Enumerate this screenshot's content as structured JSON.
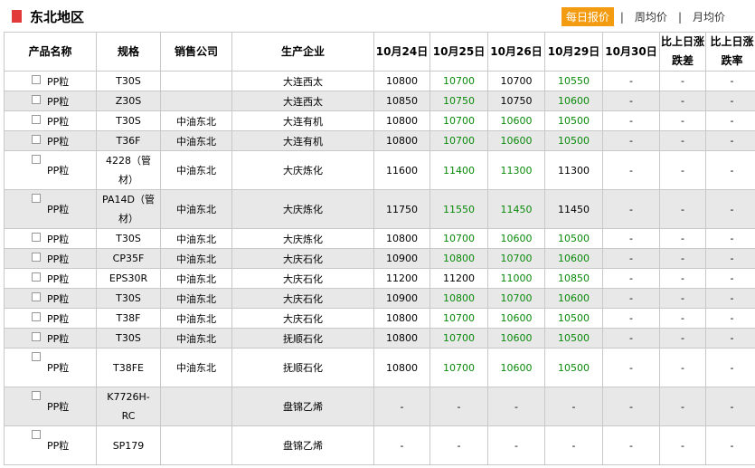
{
  "header": {
    "title": "东北地区",
    "tabs": [
      {
        "label": "每日报价",
        "active": true
      },
      {
        "label": "周均价",
        "active": false
      },
      {
        "label": "月均价",
        "active": false
      }
    ],
    "separator": "|"
  },
  "table": {
    "columns": [
      "产品名称",
      "规格",
      "销售公司",
      "生产企业",
      "10月24日",
      "10月25日",
      "10月26日",
      "10月29日",
      "10月30日",
      "比上日涨跌差",
      "比上日涨跌率"
    ],
    "rows": [
      {
        "product": "PP粒",
        "spec": "T30S",
        "seller": "",
        "producer": "大连西太",
        "d24": "10800",
        "d25": "10700",
        "d26": "10700",
        "d29": "10550",
        "d30": "-",
        "diff": "-",
        "rate": "-",
        "h": 22
      },
      {
        "product": "PP粒",
        "spec": "Z30S",
        "seller": "",
        "producer": "大连西太",
        "d24": "10850",
        "d25": "10750",
        "d26": "10750",
        "d29": "10600",
        "d30": "-",
        "diff": "-",
        "rate": "-",
        "h": 22
      },
      {
        "product": "PP粒",
        "spec": "T30S",
        "seller": "中油东北",
        "producer": "大连有机",
        "d24": "10800",
        "d25": "10700",
        "d26": "10600",
        "d29": "10500",
        "d30": "-",
        "diff": "-",
        "rate": "-",
        "h": 22
      },
      {
        "product": "PP粒",
        "spec": "T36F",
        "seller": "中油东北",
        "producer": "大连有机",
        "d24": "10800",
        "d25": "10700",
        "d26": "10600",
        "d29": "10500",
        "d30": "-",
        "diff": "-",
        "rate": "-",
        "h": 22
      },
      {
        "product": "PP粒",
        "spec": "4228（管材）",
        "seller": "中油东北",
        "producer": "大庆炼化",
        "d24": "11600",
        "d25": "11400",
        "d26": "11300",
        "d29": "11300",
        "d30": "-",
        "diff": "-",
        "rate": "-",
        "h": 43
      },
      {
        "product": "PP粒",
        "spec": "PA14D（管材）",
        "seller": "中油东北",
        "producer": "大庆炼化",
        "d24": "11750",
        "d25": "11550",
        "d26": "11450",
        "d29": "11450",
        "d30": "-",
        "diff": "-",
        "rate": "-",
        "h": 43
      },
      {
        "product": "PP粒",
        "spec": "T30S",
        "seller": "中油东北",
        "producer": "大庆炼化",
        "d24": "10800",
        "d25": "10700",
        "d26": "10600",
        "d29": "10500",
        "d30": "-",
        "diff": "-",
        "rate": "-",
        "h": 22
      },
      {
        "product": "PP粒",
        "spec": "CP35F",
        "seller": "中油东北",
        "producer": "大庆石化",
        "d24": "10900",
        "d25": "10800",
        "d26": "10700",
        "d29": "10600",
        "d30": "-",
        "diff": "-",
        "rate": "-",
        "h": 22
      },
      {
        "product": "PP粒",
        "spec": "EPS30R",
        "seller": "中油东北",
        "producer": "大庆石化",
        "d24": "11200",
        "d25": "11200",
        "d26": "11000",
        "d29": "10850",
        "d30": "-",
        "diff": "-",
        "rate": "-",
        "h": 22
      },
      {
        "product": "PP粒",
        "spec": "T30S",
        "seller": "中油东北",
        "producer": "大庆石化",
        "d24": "10900",
        "d25": "10800",
        "d26": "10700",
        "d29": "10600",
        "d30": "-",
        "diff": "-",
        "rate": "-",
        "h": 22
      },
      {
        "product": "PP粒",
        "spec": "T38F",
        "seller": "中油东北",
        "producer": "大庆石化",
        "d24": "10800",
        "d25": "10700",
        "d26": "10600",
        "d29": "10500",
        "d30": "-",
        "diff": "-",
        "rate": "-",
        "h": 22
      },
      {
        "product": "PP粒",
        "spec": "T30S",
        "seller": "中油东北",
        "producer": "抚顺石化",
        "d24": "10800",
        "d25": "10700",
        "d26": "10600",
        "d29": "10500",
        "d30": "-",
        "diff": "-",
        "rate": "-",
        "h": 22
      },
      {
        "product": "PP粒",
        "spec": "T38FE",
        "seller": "中油东北",
        "producer": "抚顺石化",
        "d24": "10800",
        "d25": "10700",
        "d26": "10600",
        "d29": "10500",
        "d30": "-",
        "diff": "-",
        "rate": "-",
        "h": 43
      },
      {
        "product": "PP粒",
        "spec": "K7726H-RC",
        "seller": "",
        "producer": "盘锦乙烯",
        "d24": "-",
        "d25": "-",
        "d26": "-",
        "d29": "-",
        "d30": "-",
        "diff": "-",
        "rate": "-",
        "h": 43
      },
      {
        "product": "PP粒",
        "spec": "SP179",
        "seller": "",
        "producer": "盘锦乙烯",
        "d24": "-",
        "d25": "-",
        "d26": "-",
        "d29": "-",
        "d30": "-",
        "diff": "-",
        "rate": "-",
        "h": 43
      }
    ]
  },
  "colors": {
    "accent": "#f39c12",
    "title_mark": "#e23a3a",
    "price_down": "#0a8a0a",
    "alt_row": "#e8e8e8"
  }
}
